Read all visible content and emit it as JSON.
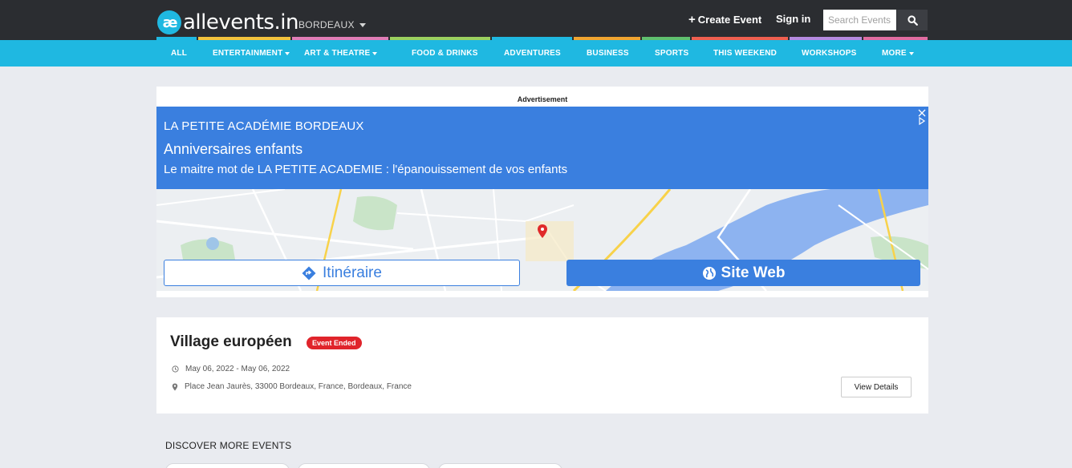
{
  "header": {
    "logo_mark": "æ",
    "logo_text": "allevents.in",
    "city": "BORDEAUX",
    "create_event": "Create Event",
    "sign_in": "Sign in",
    "search_placeholder": "Search Events"
  },
  "nav": {
    "items": [
      {
        "label": "ALL",
        "has_caret": false
      },
      {
        "label": "ENTERTAINMENT",
        "has_caret": true
      },
      {
        "label": "ART & THEATRE",
        "has_caret": true
      },
      {
        "label": "FOOD & DRINKS",
        "has_caret": false
      },
      {
        "label": "ADVENTURES",
        "has_caret": false
      },
      {
        "label": "BUSINESS",
        "has_caret": false
      },
      {
        "label": "SPORTS",
        "has_caret": false
      },
      {
        "label": "THIS WEEKEND",
        "has_caret": false
      },
      {
        "label": "WORKSHOPS",
        "has_caret": false
      },
      {
        "label": "MORE",
        "has_caret": true
      }
    ]
  },
  "ad": {
    "label": "Advertisement",
    "org": "LA PETITE ACADÉMIE BORDEAUX",
    "title": "Anniversaires enfants",
    "description": "Le maitre mot de LA PETITE ACADEMIE : l'épanouissement de vos enfants",
    "directions_button": "Itinéraire",
    "website_button": "Site Web"
  },
  "event": {
    "title": "Village européen",
    "badge": "Event Ended",
    "date": "May 06, 2022 - May 06, 2022",
    "location": "Place Jean Jaurès, 33000 Bordeaux, France, Bordeaux, France",
    "view_details": "View Details"
  },
  "discover": {
    "heading": "DISCOVER MORE EVENTS"
  },
  "colors": {
    "topbar": "#2b2d31",
    "nav": "#1fb8e1",
    "ad_blue": "#3a7fdf",
    "badge_red": "#e0242b",
    "page_bg": "#e9ebf0"
  }
}
